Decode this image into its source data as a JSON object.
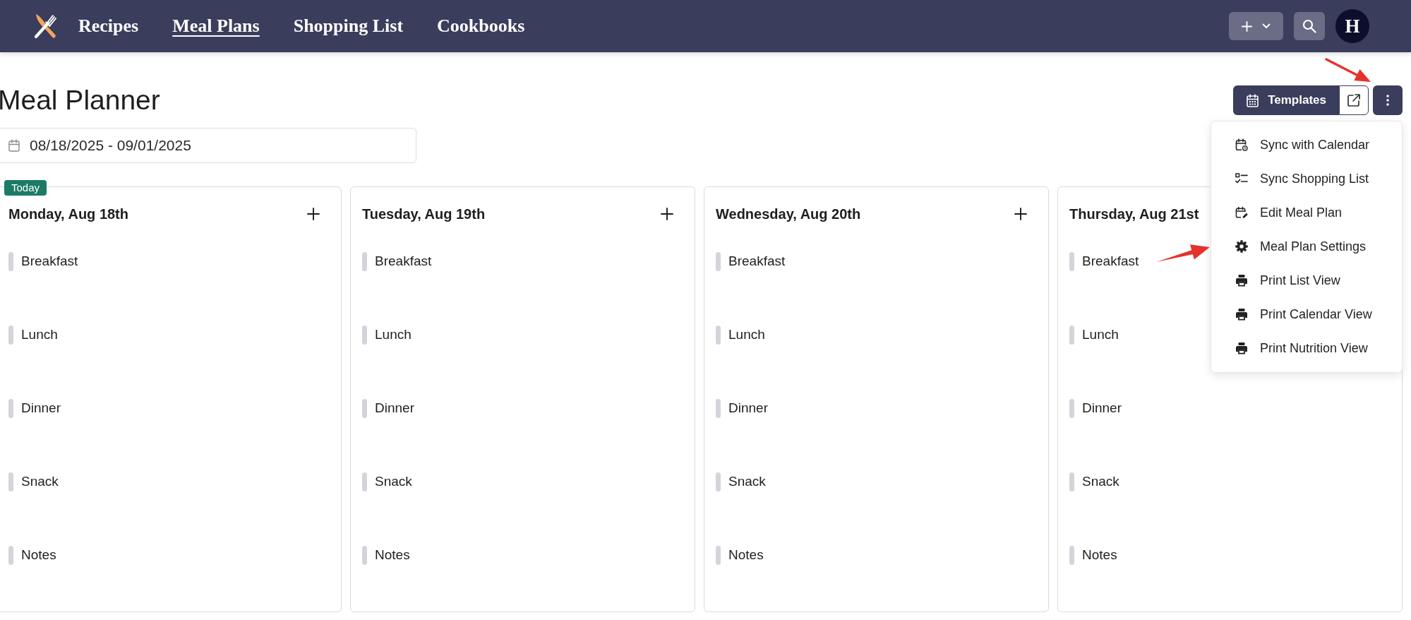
{
  "nav": {
    "links": [
      {
        "label": "Recipes",
        "selected": false
      },
      {
        "label": "Meal Plans",
        "selected": true
      },
      {
        "label": "Shopping List",
        "selected": false
      },
      {
        "label": "Cookbooks",
        "selected": false
      }
    ],
    "avatar": "H"
  },
  "page": {
    "title": "Meal Planner",
    "templates_button": "Templates"
  },
  "date_range": {
    "value": "08/18/2025 - 09/01/2025"
  },
  "menu": {
    "items": [
      {
        "label": "Sync with Calendar",
        "kind": "sync"
      },
      {
        "label": "Sync Shopping List",
        "kind": "checklist"
      },
      {
        "label": "Edit Meal Plan",
        "kind": "edit"
      },
      {
        "label": "Meal Plan Settings",
        "kind": "settings"
      },
      {
        "label": "Print List View",
        "kind": "print"
      },
      {
        "label": "Print Calendar View",
        "kind": "print"
      },
      {
        "label": "Print Nutrition View",
        "kind": "print"
      }
    ]
  },
  "days": [
    {
      "title": "Monday, Aug 18th",
      "badge": "Today",
      "add_button": true,
      "meals": [
        "Breakfast",
        "Lunch",
        "Dinner",
        "Snack",
        "Notes"
      ]
    },
    {
      "title": "Tuesday, Aug 19th",
      "add_button": true,
      "meals": [
        "Breakfast",
        "Lunch",
        "Dinner",
        "Snack",
        "Notes"
      ]
    },
    {
      "title": "Wednesday, Aug 20th",
      "add_button": true,
      "meals": [
        "Breakfast",
        "Lunch",
        "Dinner",
        "Snack",
        "Notes"
      ]
    },
    {
      "title": "Thursday, Aug 21st",
      "meals": [
        "Breakfast",
        "Lunch",
        "Dinner",
        "Snack",
        "Notes"
      ]
    }
  ]
}
